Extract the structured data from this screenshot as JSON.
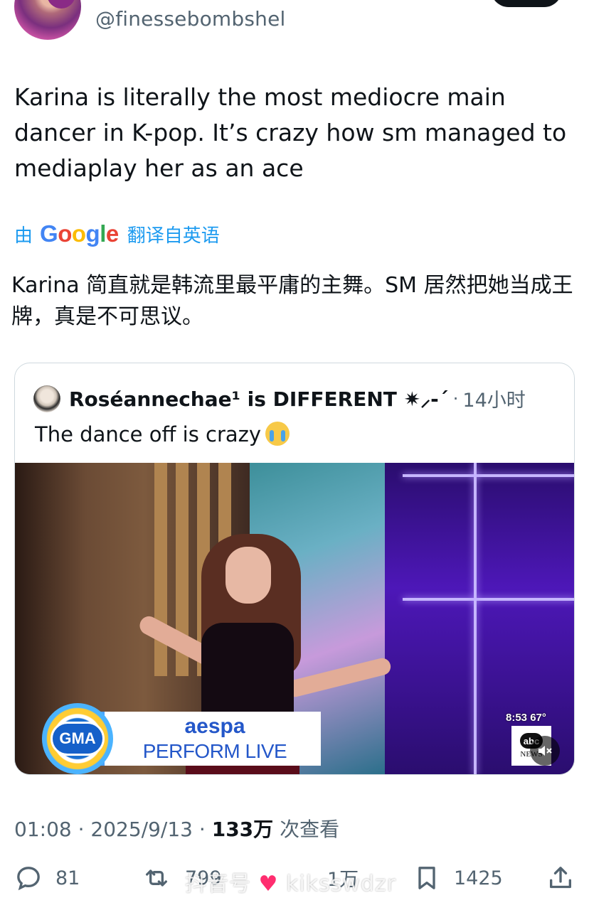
{
  "author": {
    "handle": "@finessebombshel"
  },
  "tweet": {
    "text": "Karina is literally the most mediocre main dancer in K-pop. It’s crazy how sm managed to mediaplay her as an ace",
    "translate_prefix": "由",
    "translate_brand": "Google",
    "translate_suffix": "翻译自英语",
    "translated_text": "Karina 简直就是韩流里最平庸的主舞。SM 居然把她当成王牌，真是不可思议。"
  },
  "quote": {
    "name": "Roséannechae¹ is DIFFERENT ✷⸝-´",
    "separator": "·",
    "time": "14小时",
    "text": "The dance off is crazy",
    "emoji": "loudly-crying-face",
    "video": {
      "badge": "GMA",
      "lower_third_title": "aespa",
      "lower_third_sub": "PERFORM LIVE",
      "clock": "8:53  67°",
      "network_logo": "abc",
      "network_sub": "NEWS"
    }
  },
  "meta": {
    "time": "01:08",
    "sep1": "·",
    "date": "2025/9/13",
    "sep2": "·",
    "views_count": "133万",
    "views_label": "次查看"
  },
  "actions": {
    "replies": "81",
    "reposts": "799",
    "likes": "1万",
    "bookmarks": "1425"
  },
  "watermark": {
    "text_before": "抖音号",
    "text_after": "kiksswdzr"
  },
  "colors": {
    "link_blue": "#1d9bf0",
    "secondary_text": "#536471",
    "primary_text": "#0f1419",
    "border": "#cfd9de"
  }
}
